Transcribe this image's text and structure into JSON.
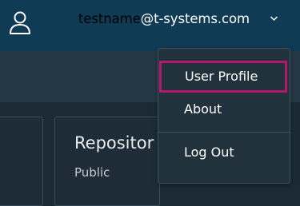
{
  "header": {
    "username": "testname",
    "domain": "@t-systems.com"
  },
  "card": {
    "title": "Repositor",
    "subtitle": "Public"
  },
  "menu": {
    "items": [
      {
        "label": "User Profile"
      },
      {
        "label": "About"
      },
      {
        "label": "Log Out"
      }
    ]
  },
  "colors": {
    "header_bg": "#0f3b55",
    "page_bg": "#1b2a35",
    "menu_bg": "#22323d",
    "highlight_border": "#b4176b"
  },
  "icons": [
    "user-icon",
    "chevron-down-icon"
  ]
}
